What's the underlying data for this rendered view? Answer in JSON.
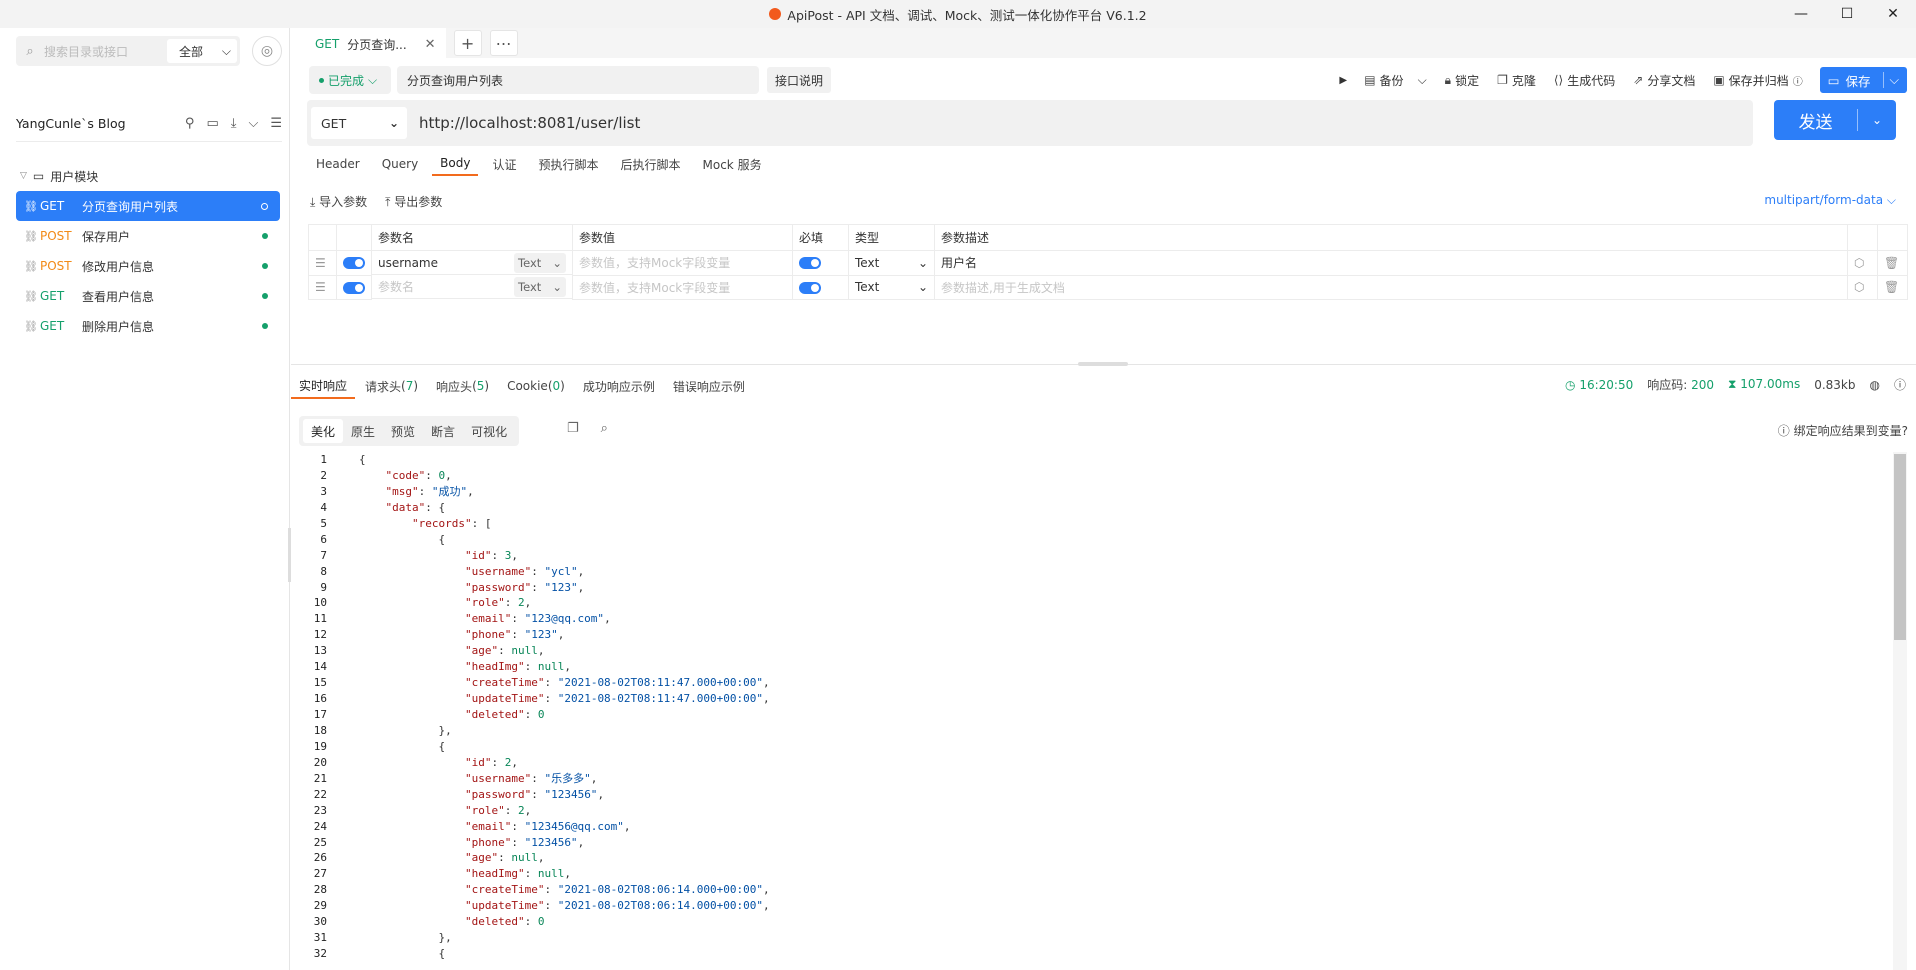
{
  "window": {
    "title": "ApiPost - API 文档、调试、Mock、测试一体化协作平台 V6.1.2",
    "minimize": "—",
    "maximize": "☐",
    "close": "✕"
  },
  "sidebar": {
    "search_placeholder": "搜索目录或接口",
    "scope": "全部",
    "project": "YangCunle`s Blog",
    "folder": "用户模块",
    "items": [
      {
        "method": "GET",
        "name": "分页查询用户列表"
      },
      {
        "method": "POST",
        "name": "保存用户"
      },
      {
        "method": "POST",
        "name": "修改用户信息"
      },
      {
        "method": "GET",
        "name": "查看用户信息"
      },
      {
        "method": "GET",
        "name": "删除用户信息"
      }
    ]
  },
  "tab": {
    "method": "GET",
    "label": "分页查询..."
  },
  "request": {
    "status": "已完成",
    "name": "分页查询用户列表",
    "desc_button": "接口说明",
    "toolbar": {
      "backup": "备份",
      "lock": "锁定",
      "clone": "克隆",
      "gen_code": "生成代码",
      "share": "分享文档",
      "save_archive": "保存并归档",
      "save": "保存"
    },
    "method": "GET",
    "url": "http://localhost:8081/user/list",
    "send": "发送"
  },
  "subtabs": [
    "Header",
    "Query",
    "Body",
    "认证",
    "预执行脚本",
    "后执行脚本",
    "Mock 服务"
  ],
  "body": {
    "import": "导入参数",
    "export": "导出参数",
    "content_type": "multipart/form-data",
    "columns": [
      "参数名",
      "参数值",
      "必填",
      "类型",
      "参数描述"
    ],
    "rows": [
      {
        "name": "username",
        "name_is_placeholder": false,
        "type_chip": "Text",
        "value": "参数值，支持Mock字段变量",
        "type": "Text",
        "desc": "用户名"
      },
      {
        "name": "参数名",
        "name_is_placeholder": true,
        "type_chip": "Text",
        "value": "参数值，支持Mock字段变量",
        "type": "Text",
        "desc": "参数描述,用于生成文档"
      }
    ]
  },
  "response": {
    "tabs": [
      {
        "label": "实时响应",
        "count": ""
      },
      {
        "label": "请求头",
        "count": "7"
      },
      {
        "label": "响应头",
        "count": "5"
      },
      {
        "label": "Cookie",
        "count": "0"
      },
      {
        "label": "成功响应示例",
        "count": ""
      },
      {
        "label": "错误响应示例",
        "count": ""
      }
    ],
    "time": "16:20:50",
    "code_label": "响应码:",
    "code": "200",
    "duration": "107.00ms",
    "size": "0.83kb",
    "formats": [
      "美化",
      "原生",
      "预览",
      "断言",
      "可视化"
    ],
    "bind_var": "绑定响应结果到变量?"
  }
}
